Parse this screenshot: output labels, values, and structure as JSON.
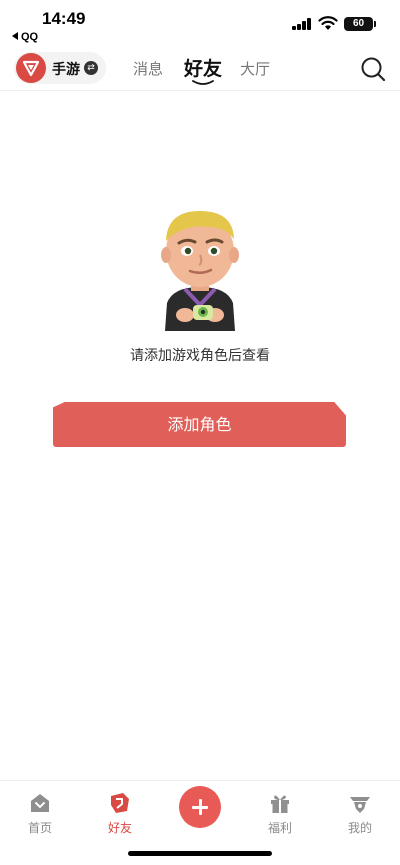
{
  "status_bar": {
    "time": "14:49",
    "back_app": "QQ",
    "battery": "60"
  },
  "top_nav": {
    "game_label": "手游",
    "tabs": [
      {
        "label": "消息",
        "active": false
      },
      {
        "label": "好友",
        "active": true
      },
      {
        "label": "大厅",
        "active": false
      }
    ]
  },
  "empty_state": {
    "message": "请添加游戏角色后查看",
    "button_label": "添加角色"
  },
  "bottom_nav": {
    "items": [
      {
        "label": "首页",
        "icon": "home-icon",
        "active": false
      },
      {
        "label": "好友",
        "icon": "friends-icon",
        "active": true
      },
      {
        "label": "福利",
        "icon": "gift-icon",
        "active": false
      },
      {
        "label": "我的",
        "icon": "profile-icon",
        "active": false
      }
    ],
    "post_icon": "plus-icon"
  },
  "colors": {
    "accent": "#e06059",
    "active_tab_icon": "#d94a45",
    "inactive": "#8a8a8a"
  }
}
